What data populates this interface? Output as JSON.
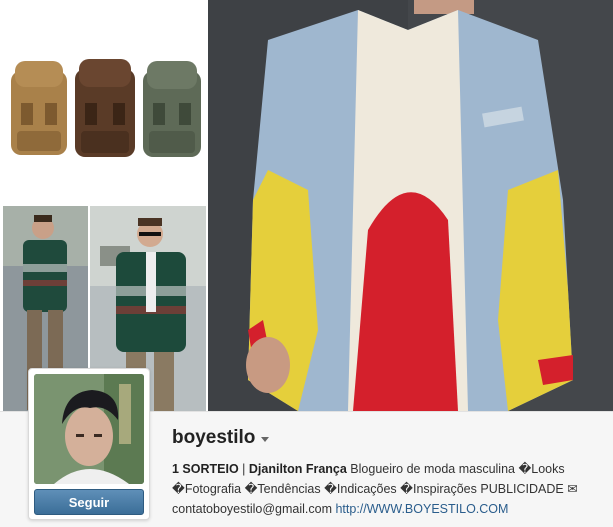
{
  "profile": {
    "username": "boyestilo",
    "follow_label": "Seguir",
    "bio": {
      "line1_bold": "1 SORTEIO",
      "sep": " | ",
      "line1_name": "Djanilton França",
      "line1_rest": " Blogueiro de moda masculina   �Looks",
      "line2": "�Fotografia �Tendências �Indicações �Inspirações    PUBLICIDADE ✉",
      "email": "contatoboyestilo@gmail.com",
      "website": "http://WWW.BOYESTILO.COM"
    }
  },
  "icons": {
    "dropdown": "chevron-down-icon"
  },
  "colors": {
    "follow_button": "#3b6e98",
    "link": "#2a5d8c",
    "background": "#f6f6f6"
  }
}
